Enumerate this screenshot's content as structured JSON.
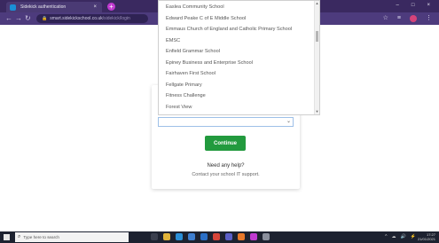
{
  "browser": {
    "tab_title": "Sidekick authentication",
    "tab_close": "×",
    "new_tab": "+",
    "window_controls": [
      "–",
      "□",
      "×"
    ],
    "nav": {
      "back": "←",
      "forward": "→",
      "reload": "↻"
    },
    "url_host": "smart.sidekickschool.co.uk",
    "url_path": "/sidekick/login",
    "lock": "🔒",
    "toolbar_icons": [
      "☆",
      "≡",
      "⋮"
    ]
  },
  "dropdown": {
    "options": [
      "Easlea Community School",
      "Edward Peake C of E Middle School",
      "Emmaus Church of England and Catholic Primary School",
      "EMSC",
      "Enfield Grammar School",
      "Epiney Business and Enterprise School",
      "Fairhaven First School",
      "Fellgate Primary",
      "Fitness Challenge",
      "Forest View"
    ],
    "scroll_up": "▲",
    "scroll_down": "▼"
  },
  "login": {
    "select_value": "",
    "select_chevron": "⌄",
    "continue_label": "Continue",
    "help_title": "Need any help?",
    "help_text": "Contact your school IT support."
  },
  "taskbar": {
    "search_icon": "⌕",
    "search_placeholder": "Type here to search",
    "app_icons": [
      {
        "name": "task-view-icon",
        "color": "#3a3f4e"
      },
      {
        "name": "file-explorer-icon",
        "color": "#e0b33a"
      },
      {
        "name": "edge-icon",
        "color": "#2a8fd8"
      },
      {
        "name": "store-icon",
        "color": "#3f7fd0"
      },
      {
        "name": "mail-icon",
        "color": "#2b6fc6"
      },
      {
        "name": "chrome-icon",
        "color": "#d6453a"
      },
      {
        "name": "teams-icon",
        "color": "#5b5fc7"
      },
      {
        "name": "firefox-icon",
        "color": "#e8792a"
      },
      {
        "name": "app-icon",
        "color": "#c03ad0"
      },
      {
        "name": "settings-icon",
        "color": "#8a8f9c"
      }
    ],
    "tray": [
      "^",
      "☁",
      "🔊",
      "⚡"
    ],
    "time": "17:27",
    "date": "21/01/2021"
  }
}
